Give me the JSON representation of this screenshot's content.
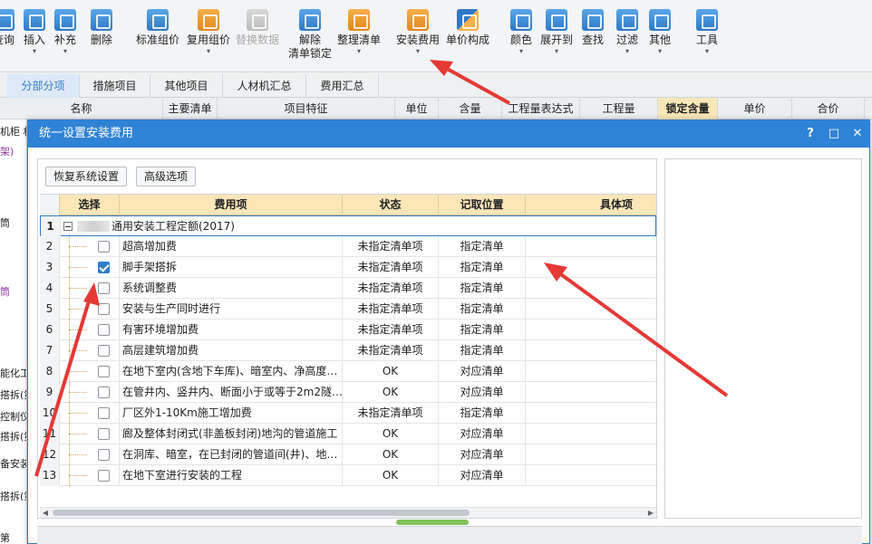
{
  "ribbon": {
    "items": [
      {
        "label": "查询",
        "icon": "search-icon"
      },
      {
        "label": "插入",
        "icon": "insert-icon"
      },
      {
        "label": "补充",
        "icon": "add-icon"
      },
      {
        "label": "删除",
        "icon": "trash-icon"
      },
      {
        "label": "标准组价",
        "icon": "standard-price-icon"
      },
      {
        "label": "复用组价",
        "icon": "reuse-price-icon"
      },
      {
        "label": "替换数据",
        "icon": "replace-data-icon"
      },
      {
        "label": "解除",
        "label2": "清单锁定",
        "icon": "unlock-icon"
      },
      {
        "label": "整理清单",
        "icon": "organize-list-icon"
      },
      {
        "label": "安装费用",
        "icon": "install-fee-icon"
      },
      {
        "label": "单价构成",
        "icon": "unit-price-icon"
      },
      {
        "label": "颜色",
        "icon": "paint-bucket-icon"
      },
      {
        "label": "展开到",
        "icon": "expand-tree-icon"
      },
      {
        "label": "查找",
        "icon": "binoculars-icon"
      },
      {
        "label": "过滤",
        "icon": "filter-icon"
      },
      {
        "label": "其他",
        "icon": "grid-apps-icon"
      },
      {
        "label": "工具",
        "icon": "tools-icon"
      }
    ]
  },
  "tabs": [
    "分部分项",
    "措施项目",
    "其他项目",
    "人材机汇总",
    "费用汇总"
  ],
  "columns": [
    "名称",
    "主要清单",
    "项目特征",
    "单位",
    "含量",
    "工程量表达式",
    "工程量",
    "锁定含量",
    "单价",
    "合价"
  ],
  "left_strip": [
    "机柜 机",
    "架)",
    "筒",
    "筒",
    "能化工",
    "搭拆(第",
    "控制仪",
    "搭拆(第",
    "备安装",
    "搭拆(第",
    "第"
  ],
  "dialog": {
    "title": "统一设置安装费用",
    "help": "?",
    "maximize": "□",
    "close": "✕",
    "restore_button": "恢复系统设置",
    "advanced_button": "高级选项",
    "headers": {
      "select": "选择",
      "fee_item": "费用项",
      "status": "状态",
      "position": "记取位置",
      "specific": "具体项"
    },
    "group_row": {
      "num": "1",
      "label": "通用安装工程定额(2017)"
    },
    "rows": [
      {
        "num": "2",
        "checked": false,
        "fee": "超高增加费",
        "status": "未指定清单项",
        "position": "指定清单"
      },
      {
        "num": "3",
        "checked": true,
        "fee": "脚手架搭拆",
        "status": "未指定清单项",
        "position": "指定清单"
      },
      {
        "num": "4",
        "checked": false,
        "fee": "系统调整费",
        "status": "未指定清单项",
        "position": "指定清单"
      },
      {
        "num": "5",
        "checked": false,
        "fee": "安装与生产同时进行",
        "status": "未指定清单项",
        "position": "指定清单"
      },
      {
        "num": "6",
        "checked": false,
        "fee": "有害环境增加费",
        "status": "未指定清单项",
        "position": "指定清单"
      },
      {
        "num": "7",
        "checked": false,
        "fee": "高层建筑增加费",
        "status": "未指定清单项",
        "position": "指定清单"
      },
      {
        "num": "8",
        "checked": false,
        "fee": "在地下室内(含地下车库)、暗室内、净高度…",
        "status": "OK",
        "position": "对应清单"
      },
      {
        "num": "9",
        "checked": false,
        "fee": "在管井内、竖井内、断面小于或等于2m2隧…",
        "status": "OK",
        "position": "对应清单"
      },
      {
        "num": "10",
        "checked": false,
        "fee": "厂区外1-10Km施工增加费",
        "status": "未指定清单项",
        "position": "指定清单"
      },
      {
        "num": "11",
        "checked": false,
        "fee": "廊及整体封闭式(非盖板封闭)地沟的管道施工",
        "status": "OK",
        "position": "对应清单"
      },
      {
        "num": "12",
        "checked": false,
        "fee": "在洞库、暗室，在已封闭的管道间(井)、地…",
        "status": "OK",
        "position": "对应清单"
      },
      {
        "num": "13",
        "checked": false,
        "fee": "在地下室进行安装的工程",
        "status": "OK",
        "position": "对应清单"
      }
    ]
  },
  "colors": {
    "accent": "#2f83d6",
    "header_yellow": "#fbe6b8",
    "arrow_red": "#e53935"
  }
}
